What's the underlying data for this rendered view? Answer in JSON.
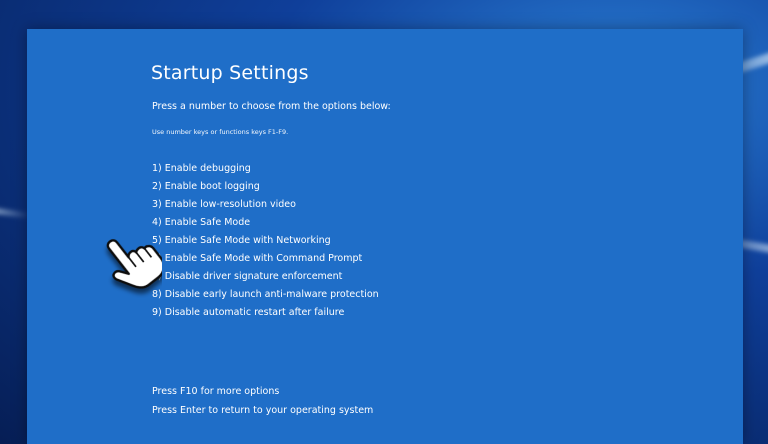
{
  "screen": {
    "title": "Startup Settings",
    "instruction": "Press a number to choose from the options below:",
    "hint": "Use number keys or functions keys F1-F9.",
    "options": [
      {
        "label": "1) Enable debugging"
      },
      {
        "label": "2) Enable boot logging"
      },
      {
        "label": "3) Enable low-resolution video"
      },
      {
        "label": "4) Enable Safe Mode"
      },
      {
        "label": "5) Enable Safe Mode with Networking"
      },
      {
        "label": "6) Enable Safe Mode with Command Prompt"
      },
      {
        "label": "7) Disable driver signature enforcement"
      },
      {
        "label": "8) Disable early launch anti-malware protection"
      },
      {
        "label": "9) Disable automatic restart after failure"
      }
    ],
    "footer": {
      "more_options": "Press F10 for more options",
      "return_os": "Press Enter to return to your operating system"
    }
  },
  "colors": {
    "panel": "#1f6ec8",
    "text": "#ffffff"
  },
  "cursor": {
    "icon": "hand-pointer-icon",
    "pointing_at_option": 5
  }
}
